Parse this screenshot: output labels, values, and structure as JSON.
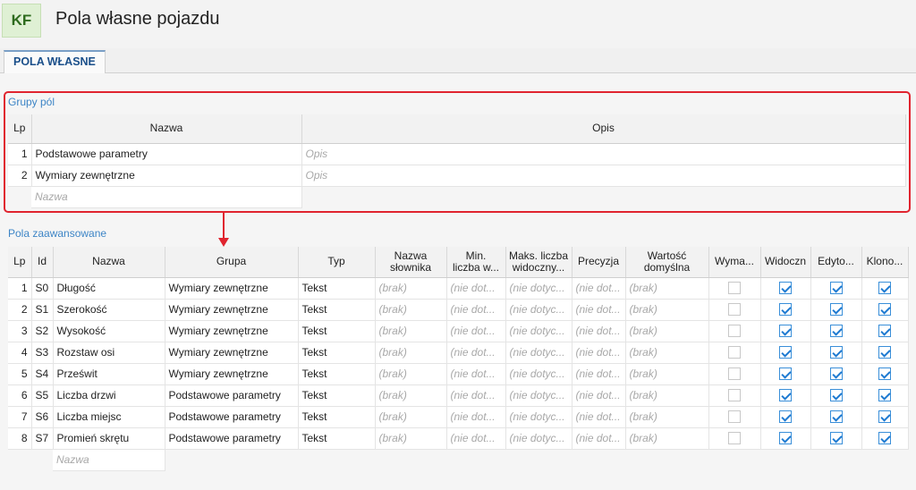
{
  "app": {
    "logo": "KF",
    "title": "Pola własne pojazdu"
  },
  "tabs": [
    {
      "label": "POLA WŁASNE",
      "active": true
    }
  ],
  "groups": {
    "section_label": "Grupy pól",
    "columns": {
      "lp": "Lp",
      "name": "Nazwa",
      "desc": "Opis"
    },
    "rows": [
      {
        "lp": "1",
        "name": "Podstawowe parametry",
        "desc": "Opis"
      },
      {
        "lp": "2",
        "name": "Wymiary zewnętrzne",
        "desc": "Opis"
      }
    ],
    "new_row_placeholder": "Nazwa"
  },
  "fields": {
    "section_label": "Pola zaawansowane",
    "columns": {
      "lp": "Lp",
      "id": "Id",
      "name": "Nazwa",
      "group": "Grupa",
      "type": "Typ",
      "dict_line1": "Nazwa",
      "dict_line2": "słownika",
      "min_line1": "Min.",
      "min_line2": "liczba w...",
      "max_line1": "Maks. liczba",
      "max_line2": "widoczny...",
      "precision": "Precyzja",
      "default_line1": "Wartość",
      "default_line2": "domyślna",
      "required": "Wyma...",
      "visible": "Widoczn",
      "editable": "Edyto...",
      "clonable": "Klono..."
    },
    "rows": [
      {
        "lp": "1",
        "id": "S0",
        "name": "Długość",
        "group": "Wymiary zewnętrzne",
        "type": "Tekst",
        "dict": "(brak)",
        "min": "(nie dot...",
        "max": "(nie dotyc...",
        "precision": "(nie dot...",
        "default": "(brak)",
        "required": false,
        "visible": true,
        "editable": true,
        "clonable": true
      },
      {
        "lp": "2",
        "id": "S1",
        "name": "Szerokość",
        "group": "Wymiary zewnętrzne",
        "type": "Tekst",
        "dict": "(brak)",
        "min": "(nie dot...",
        "max": "(nie dotyc...",
        "precision": "(nie dot...",
        "default": "(brak)",
        "required": false,
        "visible": true,
        "editable": true,
        "clonable": true
      },
      {
        "lp": "3",
        "id": "S2",
        "name": "Wysokość",
        "group": "Wymiary zewnętrzne",
        "type": "Tekst",
        "dict": "(brak)",
        "min": "(nie dot...",
        "max": "(nie dotyc...",
        "precision": "(nie dot...",
        "default": "(brak)",
        "required": false,
        "visible": true,
        "editable": true,
        "clonable": true
      },
      {
        "lp": "4",
        "id": "S3",
        "name": "Rozstaw osi",
        "group": "Wymiary zewnętrzne",
        "type": "Tekst",
        "dict": "(brak)",
        "min": "(nie dot...",
        "max": "(nie dotyc...",
        "precision": "(nie dot...",
        "default": "(brak)",
        "required": false,
        "visible": true,
        "editable": true,
        "clonable": true
      },
      {
        "lp": "5",
        "id": "S4",
        "name": "Prześwit",
        "group": "Wymiary zewnętrzne",
        "type": "Tekst",
        "dict": "(brak)",
        "min": "(nie dot...",
        "max": "(nie dotyc...",
        "precision": "(nie dot...",
        "default": "(brak)",
        "required": false,
        "visible": true,
        "editable": true,
        "clonable": true
      },
      {
        "lp": "6",
        "id": "S5",
        "name": "Liczba drzwi",
        "group": "Podstawowe parametry",
        "type": "Tekst",
        "dict": "(brak)",
        "min": "(nie dot...",
        "max": "(nie dotyc...",
        "precision": "(nie dot...",
        "default": "(brak)",
        "required": false,
        "visible": true,
        "editable": true,
        "clonable": true
      },
      {
        "lp": "7",
        "id": "S6",
        "name": "Liczba miejsc",
        "group": "Podstawowe parametry",
        "type": "Tekst",
        "dict": "(brak)",
        "min": "(nie dot...",
        "max": "(nie dotyc...",
        "precision": "(nie dot...",
        "default": "(brak)",
        "required": false,
        "visible": true,
        "editable": true,
        "clonable": true
      },
      {
        "lp": "8",
        "id": "S7",
        "name": "Promień skrętu",
        "group": "Podstawowe parametry",
        "type": "Tekst",
        "dict": "(brak)",
        "min": "(nie dot...",
        "max": "(nie dotyc...",
        "precision": "(nie dot...",
        "default": "(brak)",
        "required": false,
        "visible": true,
        "editable": true,
        "clonable": true
      }
    ],
    "new_row_placeholder": "Nazwa"
  },
  "colors": {
    "highlight_box": "#e0242f",
    "section_label": "#3d85c6",
    "checkbox_accent": "#1e7ad1"
  }
}
